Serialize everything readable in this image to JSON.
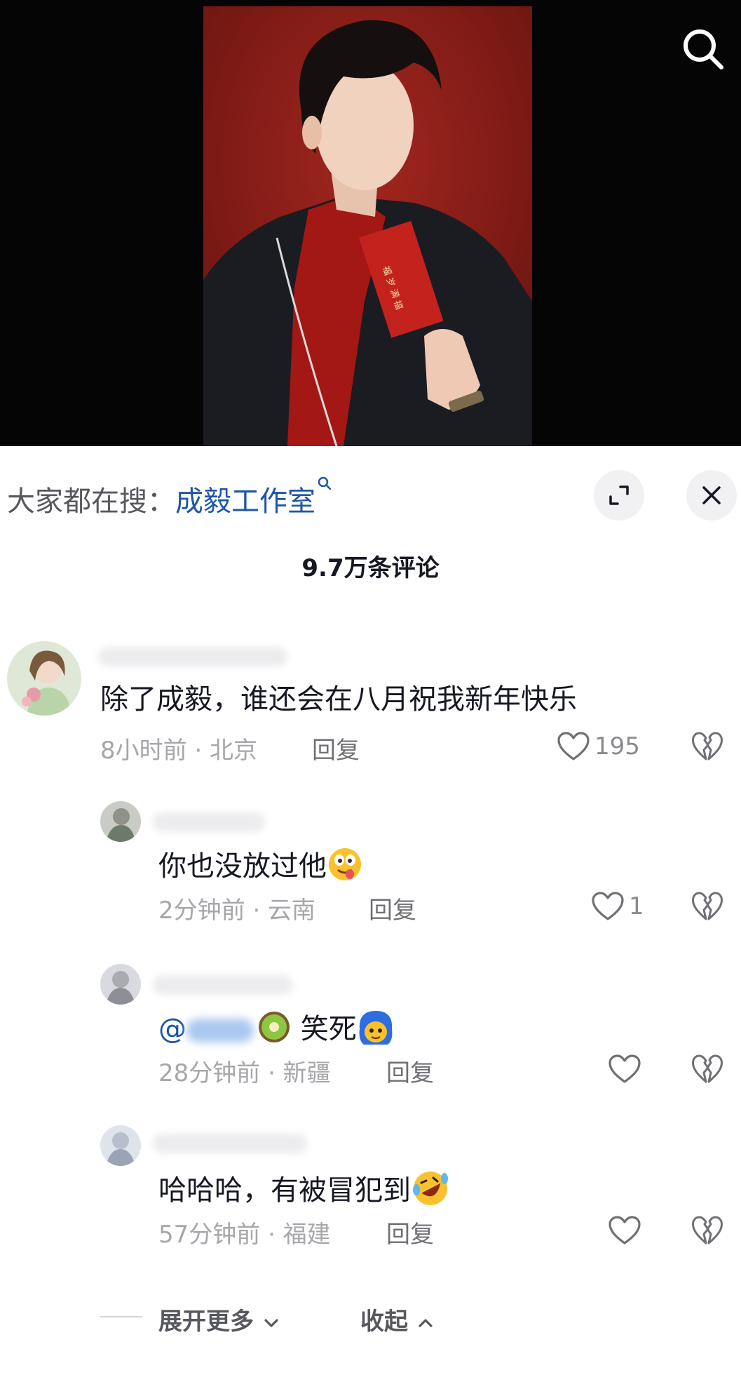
{
  "trending": {
    "prefix": "大家都在搜：",
    "keyword": "成毅工作室"
  },
  "comment_count": "9.7万条评论",
  "comments": [
    {
      "text": "除了成毅，谁还会在八月祝我新年快乐",
      "time_location": "8小时前 · 北京",
      "reply_label": "回复",
      "likes": "195"
    },
    {
      "text": "你也没放过他",
      "emoji": "drooling-face-emoji",
      "time_location": "2分钟前 · 云南",
      "reply_label": "回复",
      "likes": "1"
    },
    {
      "mention_prefix": "@",
      "text": "笑死",
      "emoji_before": "kiwi-emoji",
      "emoji": "blue-hair-face-emoji",
      "time_location": "28分钟前 · 新疆",
      "reply_label": "回复",
      "likes": ""
    },
    {
      "text": "哈哈哈，有被冒犯到",
      "emoji": "rolling-laughing-emoji",
      "time_location": "57分钟前 · 福建",
      "reply_label": "回复",
      "likes": ""
    }
  ],
  "footer": {
    "expand_more": "展开更多",
    "collapse": "收起"
  },
  "colors": {
    "link_blue": "#1e56a8",
    "photo_background": "#8e1e18",
    "envelope_red": "#c4231d"
  },
  "icons": [
    "search-icon",
    "expand-icon",
    "close-icon",
    "heart-icon",
    "broken-heart-icon",
    "chevron-down-icon",
    "chevron-up-icon",
    "search-small-icon"
  ]
}
